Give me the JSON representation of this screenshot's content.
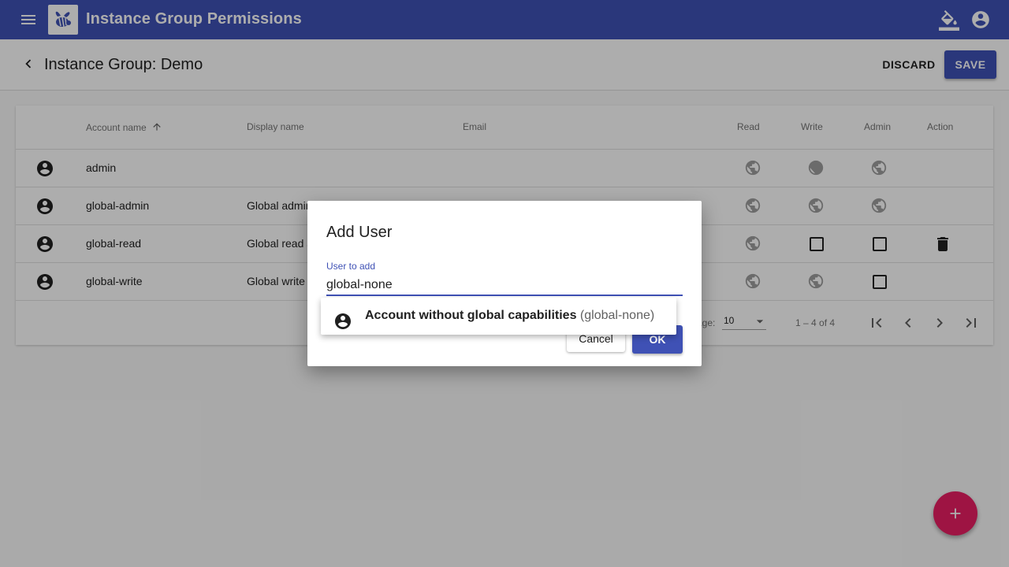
{
  "app": {
    "title": "Instance Group Permissions"
  },
  "subheader": {
    "title": "Instance Group: Demo",
    "discard_label": "DISCARD",
    "save_label": "SAVE"
  },
  "table": {
    "columns": {
      "account": "Account name",
      "display": "Display name",
      "email": "Email",
      "read": "Read",
      "write": "Write",
      "admin": "Admin",
      "action": "Action"
    },
    "rows": [
      {
        "account": "admin",
        "display": "",
        "read": "global",
        "write": "global",
        "admin": "global",
        "action": ""
      },
      {
        "account": "global-admin",
        "display": "Global admin",
        "read": "global",
        "write": "global",
        "admin": "global",
        "action": ""
      },
      {
        "account": "global-read",
        "display": "Global read a",
        "read": "global",
        "write": "unchecked",
        "admin": "unchecked",
        "action": "delete-icon"
      },
      {
        "account": "global-write",
        "display": "Global write",
        "read": "global",
        "write": "global",
        "admin": "unchecked",
        "action": ""
      }
    ],
    "paginator": {
      "items_per_page_label": "age:",
      "page_size": "10",
      "range": "1 – 4 of 4"
    }
  },
  "dialog": {
    "title": "Add User",
    "field_label": "User to add",
    "field_value": "global-none",
    "cancel_label": "Cancel",
    "ok_label": "OK"
  },
  "autocomplete": {
    "options": [
      {
        "name": "Account without global capabilities",
        "id": "(global-none)"
      }
    ]
  },
  "colors": {
    "primary": "#3f51b5",
    "accent": "#e91e63"
  }
}
